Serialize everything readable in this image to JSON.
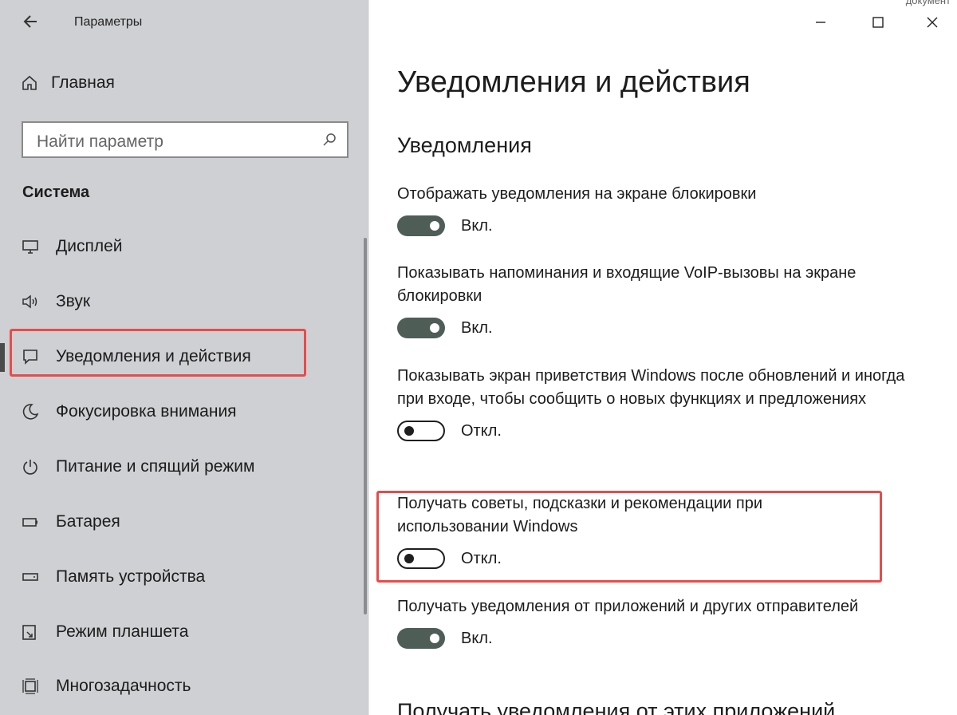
{
  "app": {
    "title": "Параметры"
  },
  "sidebar": {
    "home_label": "Главная",
    "search_placeholder": "Найти параметр",
    "section_heading": "Система",
    "items": [
      {
        "label": "Дисплей",
        "icon": "display-icon"
      },
      {
        "label": "Звук",
        "icon": "sound-icon"
      },
      {
        "label": "Уведомления и действия",
        "icon": "notification-icon",
        "active": true
      },
      {
        "label": "Фокусировка внимания",
        "icon": "moon-icon"
      },
      {
        "label": "Питание и спящий режим",
        "icon": "power-icon"
      },
      {
        "label": "Батарея",
        "icon": "battery-icon"
      },
      {
        "label": "Память устройства",
        "icon": "storage-icon"
      },
      {
        "label": "Режим планшета",
        "icon": "tablet-mode-icon"
      },
      {
        "label": "Многозадачность",
        "icon": "multitasking-icon"
      }
    ]
  },
  "window_controls": [
    "minimize-icon",
    "maximize-icon",
    "close-icon"
  ],
  "top_overlap_text": "документ",
  "main": {
    "title": "Уведомления и действия",
    "group_title": "Уведомления",
    "settings": [
      {
        "label": "Отображать уведомления на экране блокировки",
        "state": "Вкл.",
        "on": true
      },
      {
        "label": "Показывать напоминания и входящие VoIP-вызовы на экране блокировки",
        "state": "Вкл.",
        "on": true
      },
      {
        "label": "Показывать экран приветствия Windows после обновлений и иногда при входе, чтобы сообщить о новых функциях и предложениях",
        "state": "Откл.",
        "on": false
      },
      {
        "label": "Получать советы, подсказки и рекомендации при использовании Windows",
        "state": "Откл.",
        "on": false
      },
      {
        "label": "Получать уведомления от приложений и других отправителей",
        "state": "Вкл.",
        "on": true
      }
    ],
    "next_heading": "Получать уведомления от этих приложений"
  },
  "colors": {
    "sidebar_bg": "#cfd0d3",
    "toggle_on": "#4f5d57",
    "highlight": "#e84b4b"
  }
}
